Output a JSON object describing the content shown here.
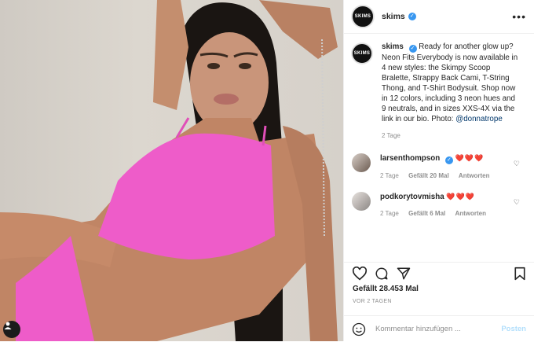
{
  "photo": {
    "alt": "Model in pink bralette"
  },
  "account": {
    "username": "skims",
    "avatar_text": "SKIMS"
  },
  "caption": {
    "username": "skims",
    "text": "Ready for another glow up? Neon Fits Everybody is now available in 4 new styles: the Skimpy Scoop Bralette, Strappy Back Cami, T-String Thong, and T-Shirt Bodysuit. Shop now in 12 colors, including 3 neon hues and 9 neutrals, and in sizes XXS-4X via the link in our bio.",
    "photo_credit_label": "Photo:",
    "photo_credit_handle": "@donnatrope",
    "time": "2 Tage"
  },
  "comments": [
    {
      "username": "larsenthompson",
      "emoji": "❤️❤️❤️",
      "time": "2 Tage",
      "likes": "Gefällt 20 Mal",
      "reply": "Antworten"
    },
    {
      "username": "podkorytovmisha",
      "emoji": "❤️❤️❤️",
      "time": "2 Tage",
      "likes": "Gefällt 6 Mal",
      "reply": "Antworten"
    }
  ],
  "actions": {
    "likes_text": "Gefällt 28.453 Mal",
    "posted_ago": "VOR 2 TAGEN"
  },
  "add_comment": {
    "placeholder": "Kommentar hinzufügen ...",
    "post_label": "Posten"
  },
  "colors": {
    "verified": "#3897f0",
    "pink": "#ee5cc9",
    "link": "#00376b"
  }
}
